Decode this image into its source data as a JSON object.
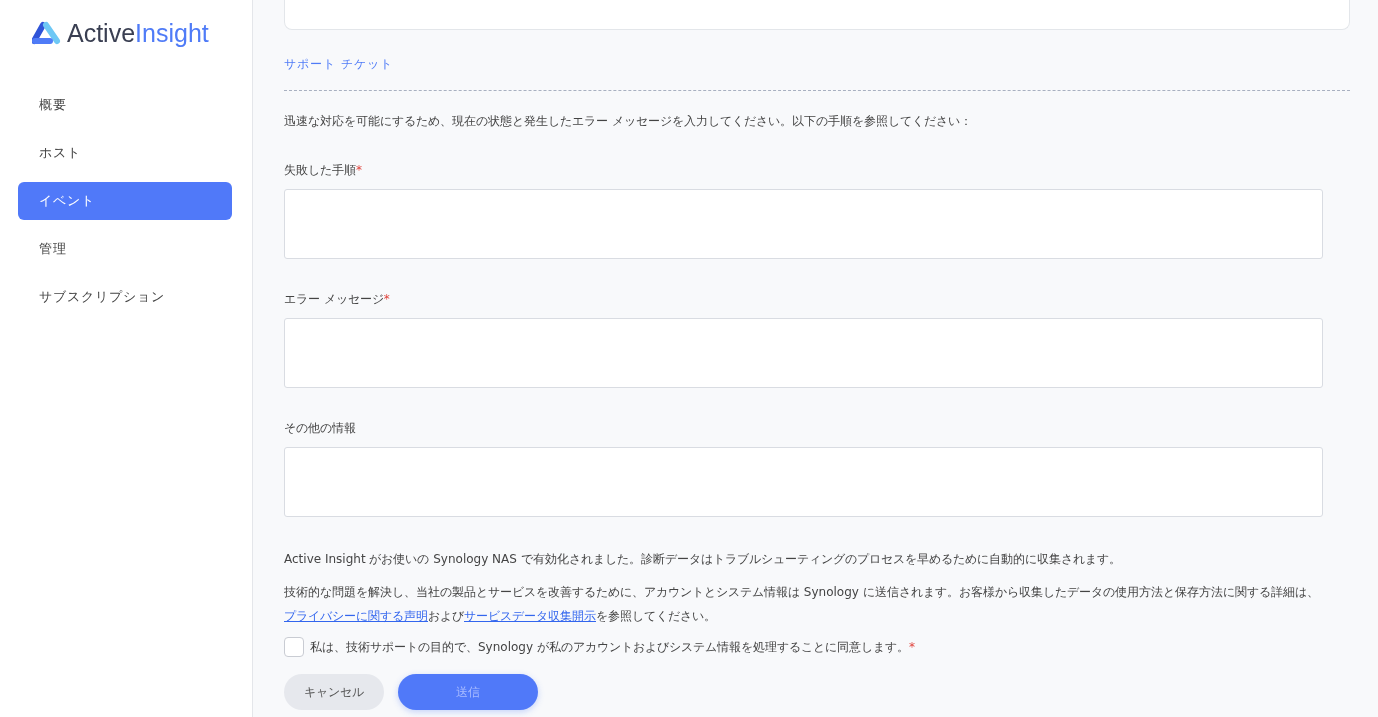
{
  "logo": {
    "part1": "Active",
    "part2": "Insight"
  },
  "nav": [
    {
      "label": "概要",
      "selected": false
    },
    {
      "label": "ホスト",
      "selected": false
    },
    {
      "label": "イベント",
      "selected": true
    },
    {
      "label": "管理",
      "selected": false
    },
    {
      "label": "サブスクリプション",
      "selected": false
    }
  ],
  "section_title": "サポート チケット",
  "intro": "迅速な対応を可能にするため、現在の状態と発生したエラー メッセージを入力してください。以下の手順を参照してください：",
  "fields": [
    {
      "label": "失敗した手順",
      "required_mark": "*"
    },
    {
      "label": "エラー メッセージ",
      "required_mark": "*"
    },
    {
      "label": "その他の情報"
    }
  ],
  "notice": "Active Insight がお使いの Synology NAS で有効化されました。診断データはトラブルシューティングのプロセスを早めるために自動的に収集されます。",
  "privacy": {
    "before": "技術的な問題を解決し、当社の製品とサービスを改善するために、アカウントとシステム情報は Synology に送信されます。お客様から収集したデータの使用方法と保存方法に関する詳細は、",
    "link1": "プライバシーに関する声明",
    "middle": "および",
    "link2": "サービスデータ収集開示",
    "after": "を参照してください。"
  },
  "consent": {
    "label": "私は、技術サポートの目的で、Synology が私のアカウントおよびシステム情報を処理することに同意します。",
    "required_mark": "*",
    "checked": false
  },
  "buttons": {
    "cancel": "キャンセル",
    "submit": "送信",
    "submit_disabled": true
  }
}
